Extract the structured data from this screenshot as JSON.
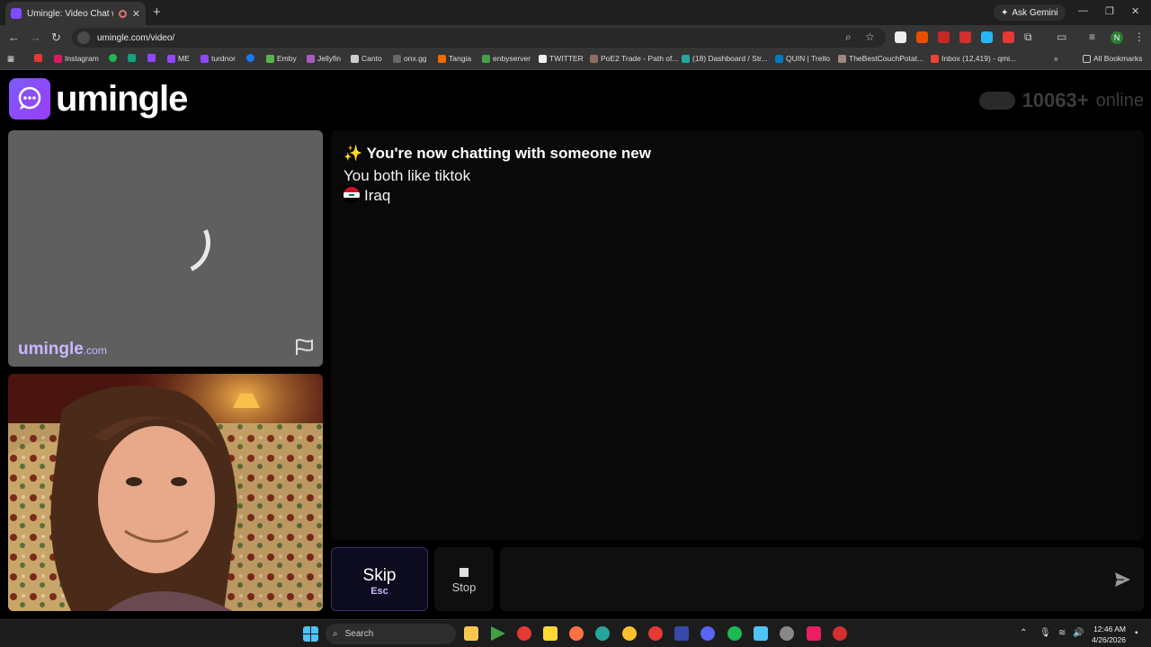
{
  "browser": {
    "tab_title": "Umingle: Video Chat with S",
    "url": "umingle.com/video/",
    "ask_gemini": "Ask Gemini",
    "profile_initial": "N",
    "bookmarks": [
      "Instagram",
      "ME",
      "turdnor",
      "Emby",
      "Jellyfin",
      "Canto",
      "onx.gg",
      "Tangia",
      "enbyserver",
      "TWITTER",
      "PoE2 Trade - Path of...",
      "(18) Dashboard / Str...",
      "QUIN | Trello",
      "TheBestCouchPotat...",
      "Inbox (12,419) - qmi..."
    ],
    "all_bookmarks": "All Bookmarks"
  },
  "site": {
    "logo_text": "umingle",
    "online_count": "10063",
    "online_plus": "+",
    "online_label": "online"
  },
  "video": {
    "watermark": "umingle",
    "watermark_domain": ".com"
  },
  "chat": {
    "header_emoji": "✨",
    "header": "You're now chatting with someone new",
    "interest": "You both like tiktok",
    "country": "Iraq"
  },
  "controls": {
    "skip_label": "Skip",
    "skip_key": "Esc",
    "stop_label": "Stop",
    "message_placeholder": ""
  },
  "taskbar": {
    "search_label": "Search",
    "time": "12:46 AM",
    "date": "4/26/2026"
  },
  "colors": {
    "brand": "#8a4dff",
    "chat_bg": "#090909",
    "stranger_bg": "#5f5f5f"
  }
}
